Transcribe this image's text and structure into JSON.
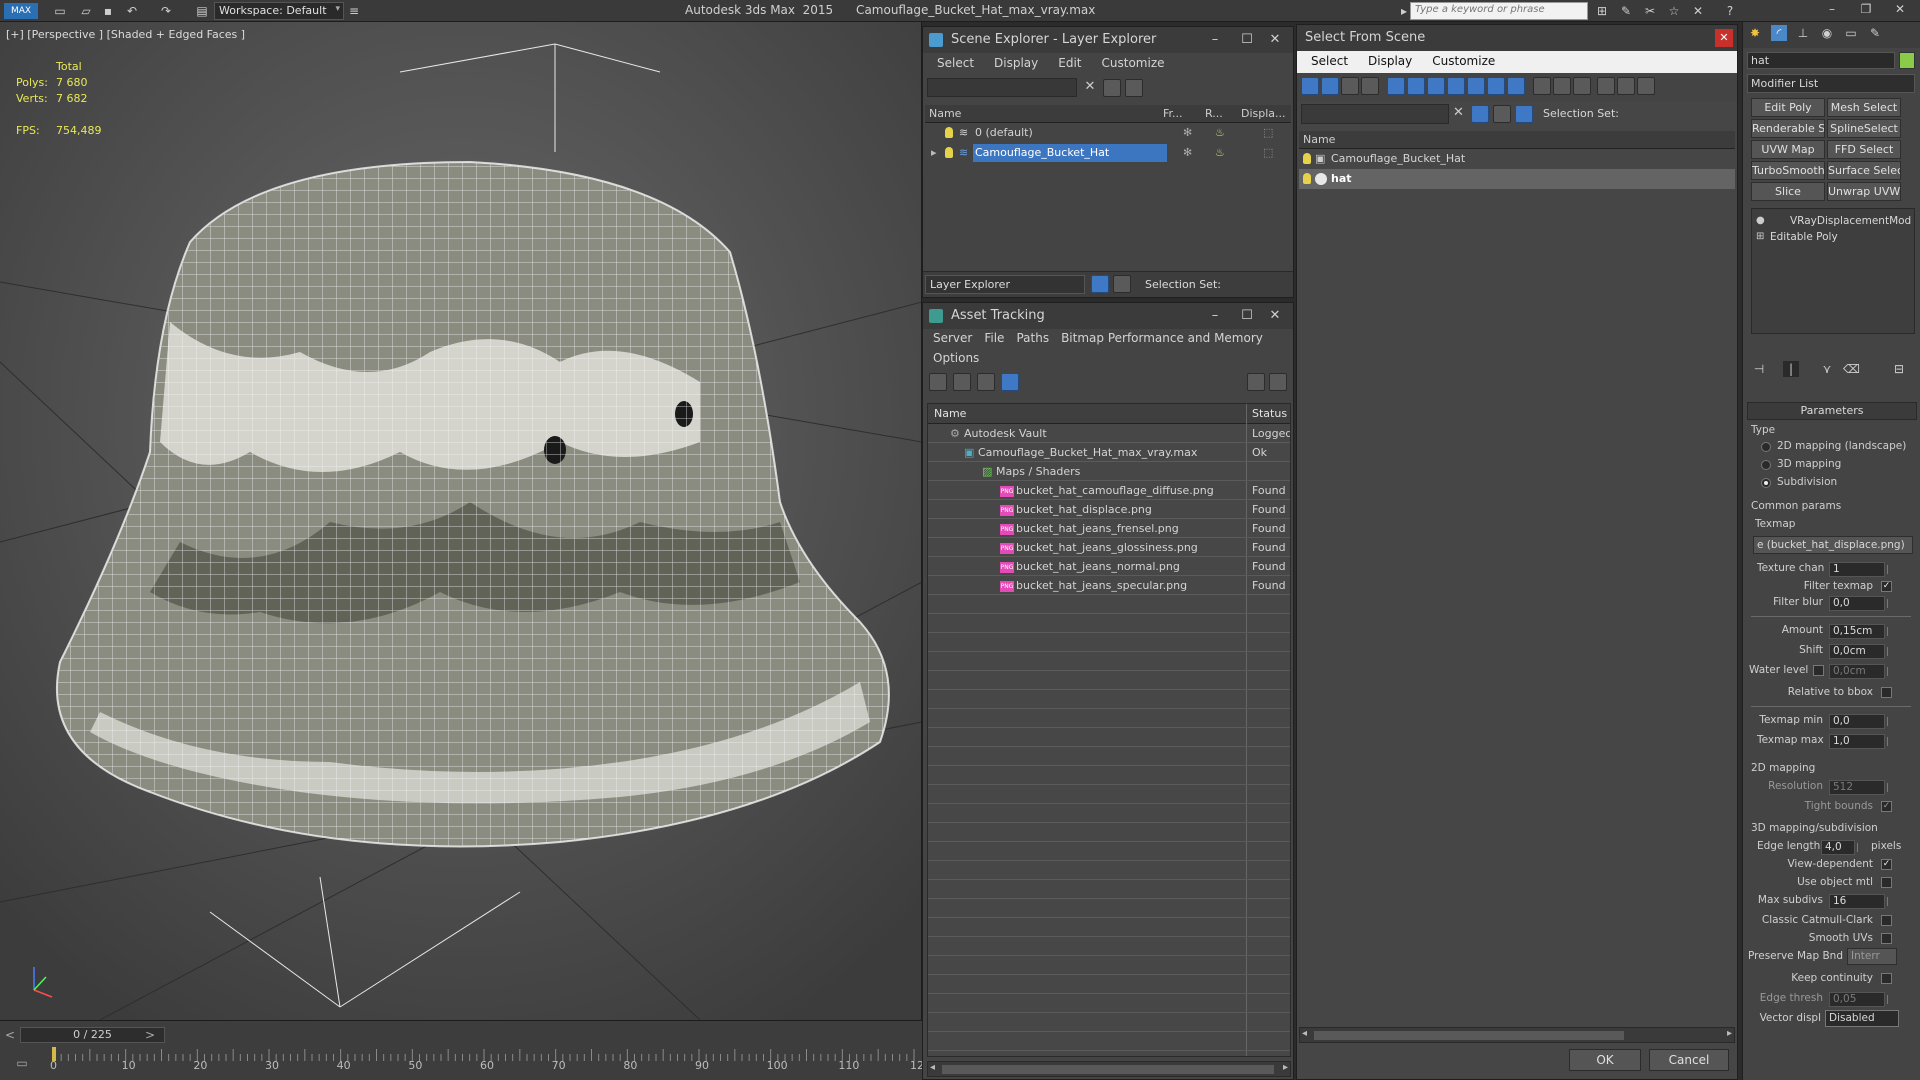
{
  "app": {
    "title": "Autodesk 3ds Max  2015      Camouflage_Bucket_Hat_max_vray.max",
    "workspace": "Workspace: Default",
    "search_placeholder": "Type a keyword or phrase"
  },
  "viewport": {
    "label": "[+] [Perspective ] [Shaded + Edged Faces ]",
    "stats": {
      "total_label": "Total",
      "polys_label": "Polys:",
      "polys": "7 680",
      "verts_label": "Verts:",
      "verts": "7 682",
      "fps_label": "FPS:",
      "fps": "754,489"
    }
  },
  "timeline": {
    "frame": "0 / 225",
    "ticks": [
      "0",
      "10",
      "20",
      "30",
      "40",
      "50",
      "60",
      "70",
      "80",
      "90",
      "100",
      "110",
      "12"
    ]
  },
  "scene_explorer": {
    "title": "Scene Explorer - Layer Explorer",
    "menu": [
      "Select",
      "Display",
      "Edit",
      "Customize"
    ],
    "columns": [
      "Name",
      "Fr...",
      "R...",
      "Displa..."
    ],
    "rows": [
      {
        "name": "0 (default)"
      },
      {
        "name": "Camouflage_Bucket_Hat"
      }
    ],
    "footer_dropdown": "Layer Explorer",
    "selection_set": "Selection Set:"
  },
  "asset_tracking": {
    "title": "Asset Tracking",
    "menu": [
      "Server",
      "File",
      "Paths",
      "Bitmap Performance and Memory"
    ],
    "menu2": "Options",
    "columns": [
      "Name",
      "Status"
    ],
    "rows": [
      {
        "name": "Autodesk Vault",
        "status": "Logged"
      },
      {
        "name": "Camouflage_Bucket_Hat_max_vray.max",
        "status": "Ok"
      },
      {
        "name": "Maps / Shaders",
        "status": ""
      },
      {
        "name": "bucket_hat_camouflage_diffuse.png",
        "status": "Found"
      },
      {
        "name": "bucket_hat_displace.png",
        "status": "Found"
      },
      {
        "name": "bucket_hat_jeans_frensel.png",
        "status": "Found"
      },
      {
        "name": "bucket_hat_jeans_glossiness.png",
        "status": "Found"
      },
      {
        "name": "bucket_hat_jeans_normal.png",
        "status": "Found"
      },
      {
        "name": "bucket_hat_jeans_specular.png",
        "status": "Found"
      }
    ]
  },
  "select_from_scene": {
    "title": "Select From Scene",
    "menu": [
      "Select",
      "Display",
      "Customize"
    ],
    "selection_set": "Selection Set:",
    "column": "Name",
    "rows": [
      {
        "name": "Camouflage_Bucket_Hat"
      },
      {
        "name": "hat"
      }
    ],
    "ok": "OK",
    "cancel": "Cancel"
  },
  "command_panel": {
    "object_name": "hat",
    "modifier_list": "Modifier List",
    "buttons": [
      "Edit Poly",
      "Mesh Select",
      "Renderable Spline",
      "SplineSelect",
      "UVW Map",
      "FFD Select",
      "TurboSmooth",
      "Surface Select",
      "Slice",
      "Unwrap UVW"
    ],
    "stack": [
      "VRayDisplacementMod",
      "Editable Poly"
    ],
    "parameters_title": "Parameters",
    "type_label": "Type",
    "type_options": [
      "2D mapping (landscape)",
      "3D mapping",
      "Subdivision"
    ],
    "common_params": "Common params",
    "texmap_label": "Texmap",
    "texmap_value": "e (bucket_hat_displace.png)",
    "texture_chan_label": "Texture chan",
    "texture_chan": "1",
    "filter_texmap_label": "Filter texmap",
    "filter_blur_label": "Filter blur",
    "filter_blur": "0,0",
    "amount_label": "Amount",
    "amount": "0,15cm",
    "shift_label": "Shift",
    "shift": "0,0cm",
    "water_level_label": "Water level",
    "water_level": "0,0cm",
    "relative_bbox_label": "Relative to bbox",
    "texmap_min_label": "Texmap min",
    "texmap_min": "0,0",
    "texmap_max_label": "Texmap max",
    "texmap_max": "1,0",
    "mapping2d_label": "2D mapping",
    "resolution_label": "Resolution",
    "resolution": "512",
    "tight_bounds_label": "Tight bounds",
    "mapping3d_label": "3D mapping/subdivision",
    "edge_length_label": "Edge length",
    "edge_length": "4,0",
    "pixels_label": "pixels",
    "view_dependent_label": "View-dependent",
    "use_object_mtl_label": "Use object mtl",
    "max_subdivs_label": "Max subdivs",
    "max_subdivs": "16",
    "classic_catmull_label": "Classic Catmull-Clark",
    "smooth_uvs_label": "Smooth UVs",
    "preserve_map_label": "Preserve Map Bnd",
    "preserve_map": "Interr",
    "keep_continuity_label": "Keep continuity",
    "edge_thresh_label": "Edge thresh",
    "edge_thresh": "0,05",
    "vector_displ_label": "Vector displ",
    "vector_displ": "Disabled"
  }
}
